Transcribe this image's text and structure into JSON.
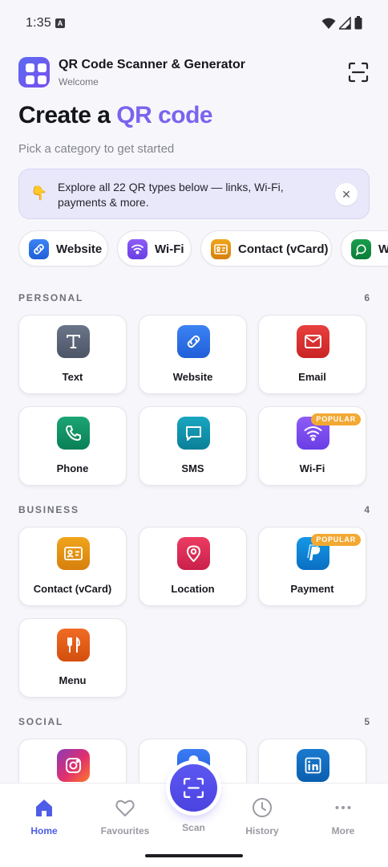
{
  "status": {
    "time": "1:35",
    "notif_badge": "A"
  },
  "header": {
    "title": "QR Code Scanner & Generator",
    "subtitle": "Welcome"
  },
  "hero": {
    "headline_plain": "Create a ",
    "headline_accent": "QR code",
    "subheadline": "Pick a category to get started"
  },
  "banner": {
    "emoji": "👇",
    "text": "Explore all 22 QR types below — links, Wi-Fi, payments & more.",
    "close_glyph": "✕"
  },
  "chips": [
    {
      "label": "Website",
      "icon": "link-icon"
    },
    {
      "label": "Wi-Fi",
      "icon": "wifi-icon"
    },
    {
      "label": "Contact (vCard)",
      "icon": "contact-card-icon"
    },
    {
      "label": "W",
      "icon": "whatsapp-icon"
    }
  ],
  "sections": {
    "personal": {
      "title": "PERSONAL",
      "count": "6",
      "items": [
        {
          "label": "Text",
          "icon": "text-icon",
          "badge": ""
        },
        {
          "label": "Website",
          "icon": "link-icon",
          "badge": ""
        },
        {
          "label": "Email",
          "icon": "mail-icon",
          "badge": ""
        },
        {
          "label": "Phone",
          "icon": "phone-icon",
          "badge": ""
        },
        {
          "label": "SMS",
          "icon": "chat-icon",
          "badge": ""
        },
        {
          "label": "Wi-Fi",
          "icon": "wifi-icon",
          "badge": "POPULAR"
        }
      ]
    },
    "business": {
      "title": "BUSINESS",
      "count": "4",
      "items": [
        {
          "label": "Contact (vCard)",
          "icon": "contact-card-icon",
          "badge": ""
        },
        {
          "label": "Location",
          "icon": "location-pin-icon",
          "badge": ""
        },
        {
          "label": "Payment",
          "icon": "paypal-icon",
          "badge": "POPULAR"
        },
        {
          "label": "Menu",
          "icon": "fork-knife-icon",
          "badge": ""
        }
      ]
    },
    "social": {
      "title": "SOCIAL",
      "count": "5",
      "items": [
        {
          "label": "",
          "icon": "instagram-icon"
        },
        {
          "label": "",
          "icon": "facebook-icon"
        },
        {
          "label": "",
          "icon": "linkedin-icon"
        }
      ]
    }
  },
  "nav": {
    "home": "Home",
    "favourites": "Favourites",
    "scan": "Scan",
    "history": "History",
    "more": "More"
  },
  "colors": {
    "accent": "#7a64ee",
    "nav_active": "#4d5de8",
    "fab": "#5048e6",
    "badge": "#f2a933"
  }
}
